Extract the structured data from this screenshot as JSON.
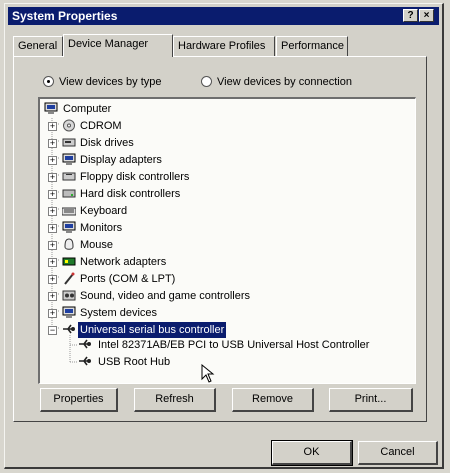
{
  "window": {
    "title": "System Properties",
    "help_label": "?",
    "close_label": "×"
  },
  "tabs": [
    {
      "label": "General"
    },
    {
      "label": "Device Manager"
    },
    {
      "label": "Hardware Profiles"
    },
    {
      "label": "Performance"
    }
  ],
  "view": {
    "by_type": "View devices by type",
    "by_connection": "View devices by connection",
    "selected": "by_type"
  },
  "tree": {
    "root": "Computer",
    "items": [
      {
        "label": "CDROM",
        "icon": "cdrom-icon"
      },
      {
        "label": "Disk drives",
        "icon": "disk-drive-icon"
      },
      {
        "label": "Display adapters",
        "icon": "display-adapter-icon"
      },
      {
        "label": "Floppy disk controllers",
        "icon": "floppy-controller-icon"
      },
      {
        "label": "Hard disk controllers",
        "icon": "hard-disk-controller-icon"
      },
      {
        "label": "Keyboard",
        "icon": "keyboard-icon"
      },
      {
        "label": "Monitors",
        "icon": "monitor-icon"
      },
      {
        "label": "Mouse",
        "icon": "mouse-icon"
      },
      {
        "label": "Network adapters",
        "icon": "network-adapter-icon"
      },
      {
        "label": "Ports (COM & LPT)",
        "icon": "port-icon"
      },
      {
        "label": "Sound, video and game controllers",
        "icon": "sound-icon"
      },
      {
        "label": "System devices",
        "icon": "system-device-icon"
      },
      {
        "label": "Universal serial bus controller",
        "icon": "usb-icon",
        "selected": true
      }
    ],
    "usb_children": [
      {
        "label": "Intel 82371AB/EB PCI to USB Universal Host Controller",
        "icon": "usb-icon"
      },
      {
        "label": "USB Root Hub",
        "icon": "usb-icon"
      }
    ]
  },
  "buttons": {
    "properties": "Properties",
    "refresh": "Refresh",
    "remove": "Remove",
    "print": "Print...",
    "ok": "OK",
    "cancel": "Cancel"
  },
  "colors": {
    "title_bar": "#0a1c6e",
    "selection": "#0a1c6e",
    "face": "#d3d1c9"
  }
}
